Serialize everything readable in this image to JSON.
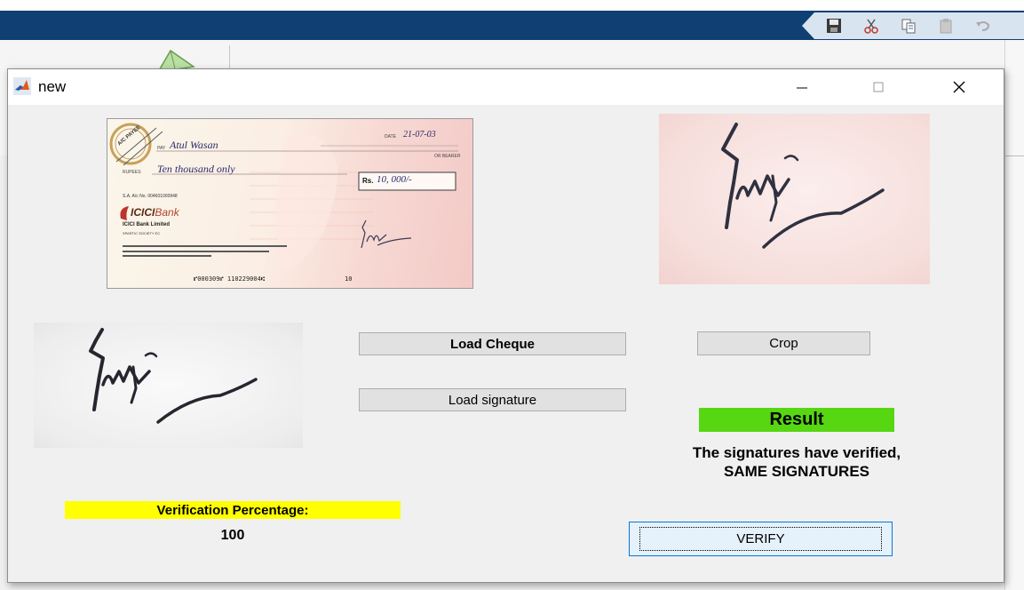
{
  "window": {
    "title": "new"
  },
  "icons": {
    "app": "matlab-icon",
    "minimize": "minimize-icon",
    "maximize": "maximize-icon",
    "close": "close-icon",
    "save": "save-icon",
    "cut": "cut-icon",
    "copy": "copy-icon",
    "paste": "paste-icon",
    "undo": "undo-icon"
  },
  "cheque": {
    "stamp": "A/C PAYEE",
    "date_label": "DATE",
    "date": "21-07-03",
    "pay_label": "PAY",
    "payee": "Atul Wasan",
    "bearer": "OR BEARER",
    "rupees_label": "RUPEES",
    "amount_words": "Ten thousand only",
    "amount_label": "Rs.",
    "amount_figures": "10, 000/-",
    "account_no": "S.A. A/c No. 004601000948",
    "bank_logo": "ICICI",
    "bank_logo_suffix": "Bank",
    "bank_name": "ICICI Bank Limited",
    "branch": "SPARTIC SOCIETY EC",
    "micr": "⑈000309⑈ 110229004⑆",
    "micr_end": "10"
  },
  "buttons": {
    "load_cheque": "Load Cheque",
    "load_signature": "Load signature",
    "crop": "Crop",
    "verify": "VERIFY"
  },
  "result": {
    "badge": "Result",
    "badge_color": "#57d612",
    "line1": "The signatures have verified,",
    "line2": "SAME SIGNATURES"
  },
  "verification": {
    "label": "Verification Percentage:",
    "label_bg": "#ffff00",
    "value": "100"
  }
}
